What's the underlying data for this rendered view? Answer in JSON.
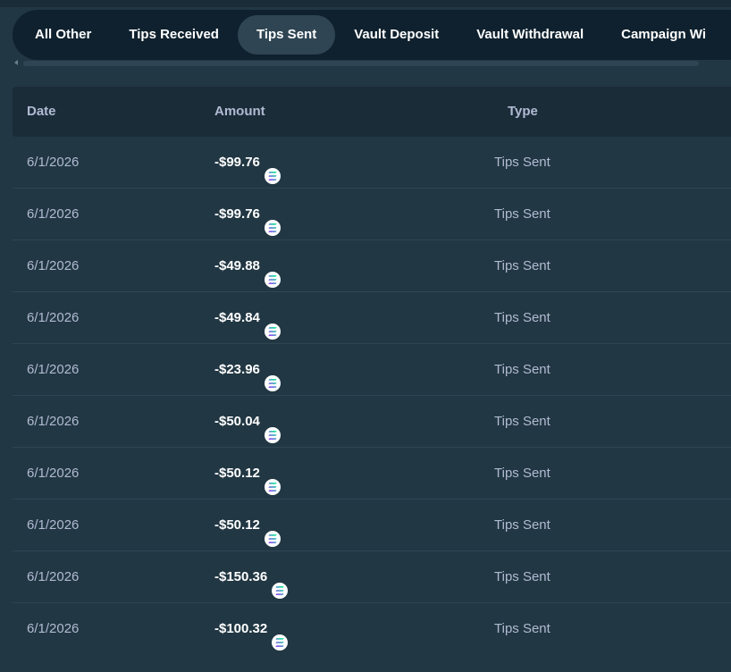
{
  "tabs": [
    {
      "label": "All Other",
      "active": false
    },
    {
      "label": "Tips Received",
      "active": false
    },
    {
      "label": "Tips Sent",
      "active": true
    },
    {
      "label": "Vault Deposit",
      "active": false
    },
    {
      "label": "Vault Withdrawal",
      "active": false
    },
    {
      "label": "Campaign Wi",
      "active": false
    }
  ],
  "table": {
    "headers": {
      "date": "Date",
      "amount": "Amount",
      "type": "Type"
    },
    "rows": [
      {
        "date": "6/1/2026",
        "amount": "-$99.76",
        "type": "Tips Sent",
        "currency_icon": "solana-coin-icon"
      },
      {
        "date": "6/1/2026",
        "amount": "-$99.76",
        "type": "Tips Sent",
        "currency_icon": "solana-coin-icon"
      },
      {
        "date": "6/1/2026",
        "amount": "-$49.88",
        "type": "Tips Sent",
        "currency_icon": "solana-coin-icon"
      },
      {
        "date": "6/1/2026",
        "amount": "-$49.84",
        "type": "Tips Sent",
        "currency_icon": "solana-coin-icon"
      },
      {
        "date": "6/1/2026",
        "amount": "-$23.96",
        "type": "Tips Sent",
        "currency_icon": "solana-coin-icon"
      },
      {
        "date": "6/1/2026",
        "amount": "-$50.04",
        "type": "Tips Sent",
        "currency_icon": "solana-coin-icon"
      },
      {
        "date": "6/1/2026",
        "amount": "-$50.12",
        "type": "Tips Sent",
        "currency_icon": "solana-coin-icon"
      },
      {
        "date": "6/1/2026",
        "amount": "-$50.12",
        "type": "Tips Sent",
        "currency_icon": "solana-coin-icon"
      },
      {
        "date": "6/1/2026",
        "amount": "-$150.36",
        "type": "Tips Sent",
        "currency_icon": "solana-coin-icon"
      },
      {
        "date": "6/1/2026",
        "amount": "-$100.32",
        "type": "Tips Sent",
        "currency_icon": "solana-coin-icon"
      }
    ]
  },
  "colors": {
    "background": "#213743",
    "tabbar": "#0f212e",
    "active_tab": "#2f4553",
    "header": "#1a2c38",
    "muted_text": "#b1bad3"
  }
}
